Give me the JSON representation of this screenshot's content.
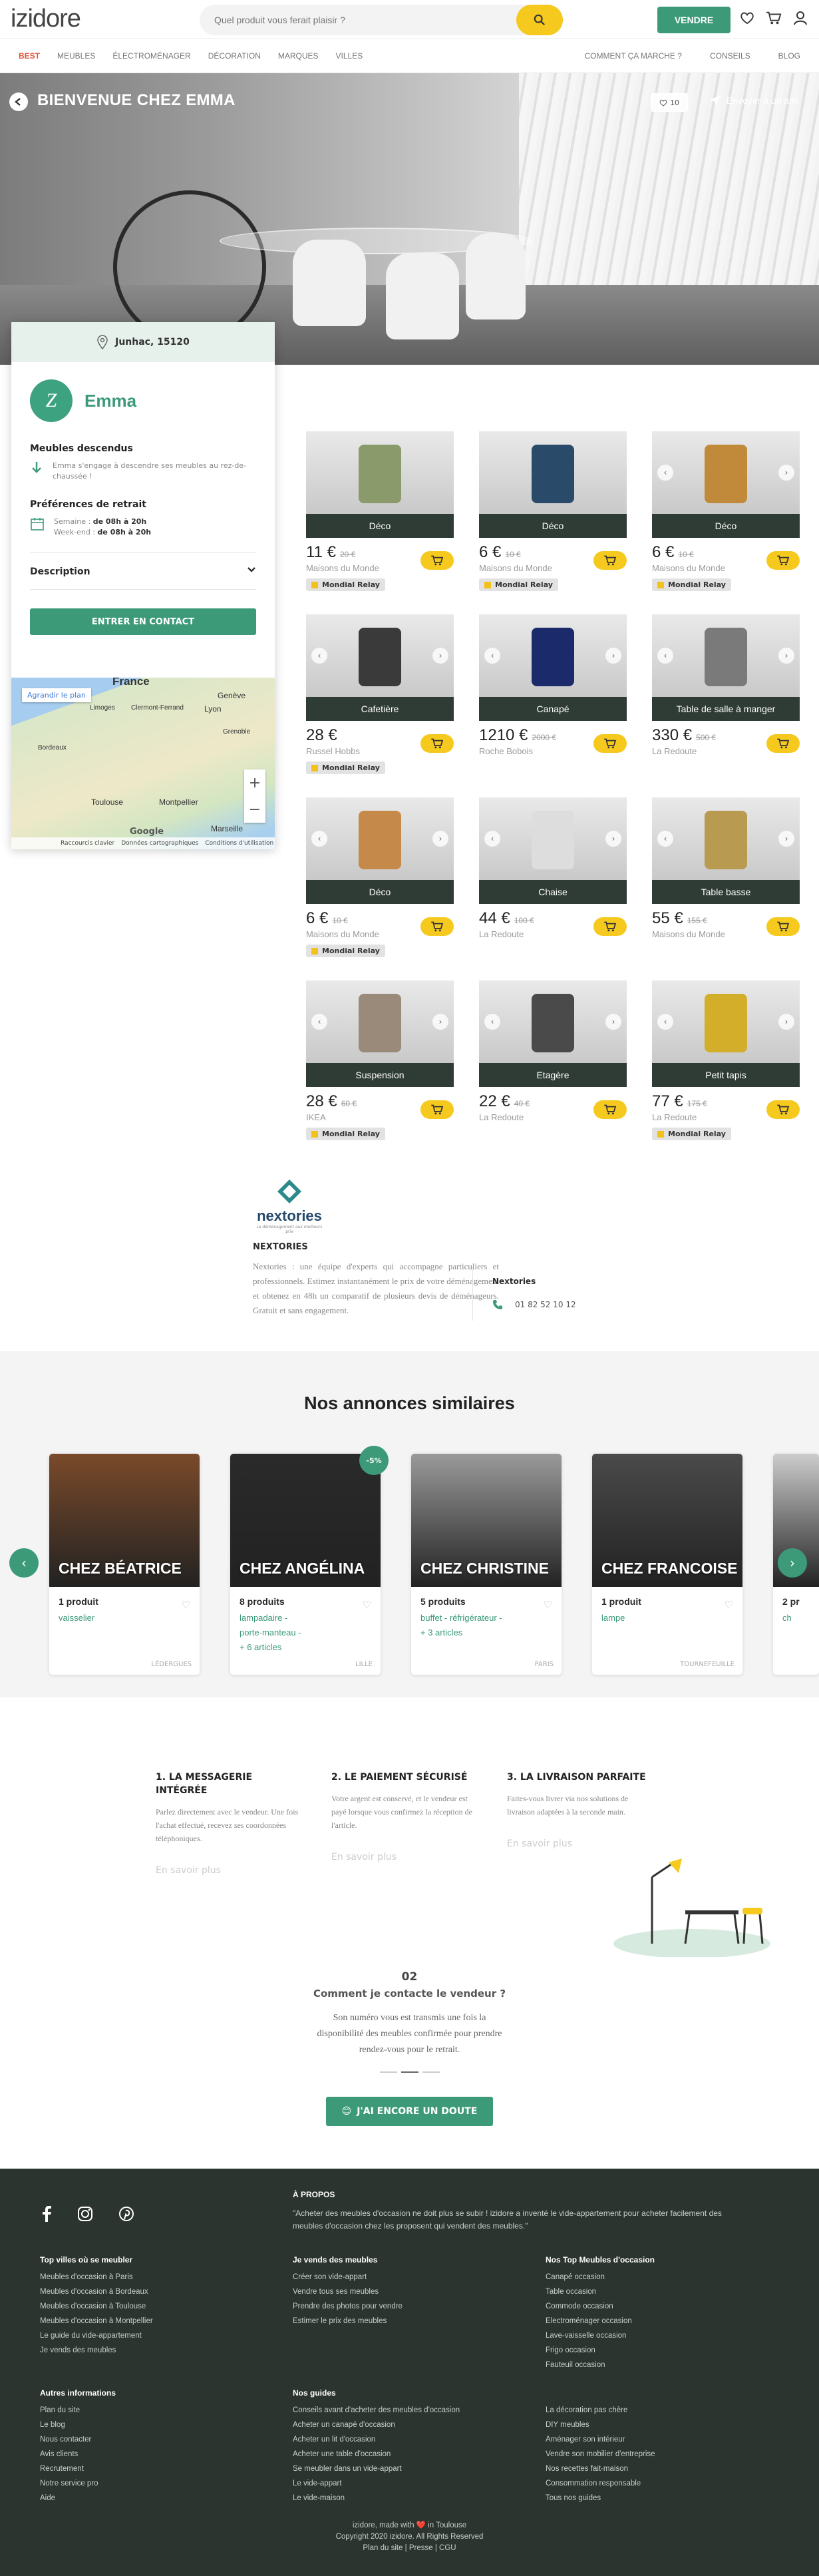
{
  "header": {
    "logo": "izidore",
    "search_placeholder": "Quel produit vous ferait plaisir ?",
    "sell_label": "VENDRE"
  },
  "nav": {
    "left": [
      "BEST",
      "MEUBLES",
      "ÉLECTROMÉNAGER",
      "DÉCORATION",
      "MARQUES",
      "VILLES"
    ],
    "right": [
      "COMMENT ÇA MARCHE ?",
      "CONSEILS",
      "BLOG"
    ]
  },
  "hero": {
    "title": "BIENVENUE CHEZ EMMA",
    "fav_count": "10",
    "share_label": "Envoyer à un ami"
  },
  "seller": {
    "location": "Junhac, 15120",
    "initial": "Z",
    "name": "Emma",
    "carry_title": "Meubles descendus",
    "carry_text": "Emma s'engage à descendre ses meubles au rez-de-chaussée !",
    "pickup_title": "Préférences de retrait",
    "week_label": "Semaine :",
    "week_hours": "de 08h à 20h",
    "weekend_label": "Week-end :",
    "weekend_hours": "de 08h à 20h",
    "desc_label": "Description",
    "contact_label": "ENTRER EN CONTACT"
  },
  "map": {
    "enlarge": "Agrandir le plan",
    "google": "Google",
    "attrib": [
      "Raccourcis clavier",
      "Données cartographiques",
      "Conditions d'utilisation"
    ],
    "cities": [
      "France",
      "Genève",
      "Limoges",
      "Clermont-Ferrand",
      "Lyon",
      "Grenoble",
      "Bordeaux",
      "Toulouse",
      "Montpellier",
      "Marseille"
    ]
  },
  "products": [
    {
      "cat": "Déco",
      "price": "11 €",
      "old": "20 €",
      "brand": "Maisons du Monde",
      "relay": "Mondial Relay",
      "color": "#8a9a6a"
    },
    {
      "cat": "Déco",
      "price": "6 €",
      "old": "10 €",
      "brand": "Maisons du Monde",
      "relay": "Mondial Relay",
      "color": "#2a4a6a"
    },
    {
      "cat": "Déco",
      "price": "6 €",
      "old": "10 €",
      "brand": "Maisons du Monde",
      "relay": "Mondial Relay",
      "color": "#c08a3a"
    },
    {
      "cat": "Cafetière",
      "price": "28 €",
      "old": "",
      "brand": "Russel Hobbs",
      "relay": "Mondial Relay",
      "color": "#3a3a3a"
    },
    {
      "cat": "Canapé",
      "price": "1210 €",
      "old": "2000 €",
      "brand": "Roche Bobois",
      "relay": "",
      "color": "#1a2a6a"
    },
    {
      "cat": "Table de salle à manger",
      "price": "330 €",
      "old": "500 €",
      "brand": "La Redoute",
      "relay": "",
      "color": "#7a7a7a"
    },
    {
      "cat": "Déco",
      "price": "6 €",
      "old": "10 €",
      "brand": "Maisons du Monde",
      "relay": "Mondial Relay",
      "color": "#c58a4a"
    },
    {
      "cat": "Chaise",
      "price": "44 €",
      "old": "100 €",
      "brand": "La Redoute",
      "relay": "",
      "color": "#dddddd"
    },
    {
      "cat": "Table basse",
      "price": "55 €",
      "old": "155 €",
      "brand": "Maisons du Monde",
      "relay": "",
      "color": "#b89a50"
    },
    {
      "cat": "Suspension",
      "price": "28 €",
      "old": "60 €",
      "brand": "IKEA",
      "relay": "Mondial Relay",
      "color": "#9a8a7a"
    },
    {
      "cat": "Etagère",
      "price": "22 €",
      "old": "40 €",
      "brand": "La Redoute",
      "relay": "",
      "color": "#4a4a4a"
    },
    {
      "cat": "Petit tapis",
      "price": "77 €",
      "old": "175 €",
      "brand": "La Redoute",
      "relay": "Mondial Relay",
      "color": "#d2ae2a"
    }
  ],
  "partner": {
    "logo": "nextories",
    "tagline": "Le déménagement aux meilleurs prix",
    "name": "NEXTORIES",
    "text": "Nextories : une équipe d'experts qui accompagne particuliers et professionnels. Estimez instantanément le prix de votre déménagement et obtenez en 48h un comparatif de plusieurs devis de déménageurs. Gratuit et sans engagement.",
    "contact_name": "Nextories",
    "phone": "01 82 52 10 12"
  },
  "similar": {
    "title": "Nos annonces similaires",
    "discount": "-5%",
    "cards": [
      {
        "name": "CHEZ BÉATRICE",
        "count": "1 produit",
        "tags": [
          "vaisselier"
        ],
        "city": "LÉDERGUES",
        "color": "#7a4a2a"
      },
      {
        "name": "CHEZ ANGÉLINA",
        "count": "8 produits",
        "tags": [
          "lampadaire -",
          "porte-manteau -",
          "+ 6 articles"
        ],
        "city": "LILLE",
        "color": "#2a2a2a"
      },
      {
        "name": "CHEZ CHRISTINE",
        "count": "5 produits",
        "tags": [
          "buffet - réfrigérateur -",
          "+ 3 articles"
        ],
        "city": "PARIS",
        "color": "#9a9a9a"
      },
      {
        "name": "CHEZ FRANCOISE",
        "count": "1 produit",
        "tags": [
          "lampe"
        ],
        "city": "TOURNEFEUILLE",
        "color": "#4a4a4a"
      },
      {
        "name": "",
        "count": "2 pr",
        "tags": [
          "ch"
        ],
        "city": "",
        "color": "#cccccc"
      }
    ]
  },
  "steps": [
    {
      "title": "1. LA MESSAGERIE INTÉGRÉE",
      "text": "Parlez directement avec le vendeur. Une fois l'achat effectué, recevez ses coordonnées téléphoniques.",
      "more": "En savoir plus"
    },
    {
      "title": "2. LE PAIEMENT SÉCURISÉ",
      "text": "Votre argent est conservé, et le vendeur est payé lorsque vous confirmez la réception de l'article.",
      "more": "En savoir plus"
    },
    {
      "title": "3. LA LIVRAISON PARFAITE",
      "text": "Faites-vous livrer via nos solutions de livraison adaptées à la seconde main.",
      "more": "En savoir plus"
    }
  ],
  "faq": {
    "num": "02",
    "question": "Comment je contacte le vendeur ?",
    "answer": "Son numéro vous est transmis une fois la disponibilité des meubles confirmée pour prendre rendez-vous pour le retrait.",
    "button": "J'AI ENCORE UN DOUTE"
  },
  "footer": {
    "about_title": "À PROPOS",
    "about_text": "\"Acheter des meubles d'occasion ne doit plus se subir ! izidore a inventé le vide-appartement pour acheter facilement des meubles d'occasion chez les proposent qui vendent des meubles.\"",
    "col1_title": "Top villes où se meubler",
    "col1": [
      "Meubles d'occasion à Paris",
      "Meubles d'occasion à Bordeaux",
      "Meubles d'occasion à Toulouse",
      "Meubles d'occasion à Montpellier",
      "Le guide du vide-appartement",
      "Je vends des meubles"
    ],
    "col2_title": "Je vends des meubles",
    "col2": [
      "Créer son vide-appart",
      "Vendre tous ses meubles",
      "Prendre des photos pour vendre",
      "Estimer le prix des meubles"
    ],
    "col3_title": "Nos Top Meubles d'occasion",
    "col3": [
      "Canapé occasion",
      "Table occasion",
      "Commode occasion",
      "Electroménager occasion",
      "Lave-vaisselle occasion",
      "Frigo occasion",
      "Fauteuil occasion"
    ],
    "col4_title": "Autres informations",
    "col4": [
      "Plan du site",
      "Le blog",
      "Nous contacter",
      "Avis clients",
      "Recrutement",
      "Notre service pro",
      "Aide"
    ],
    "col5_title": "Nos guides",
    "col5": [
      "Conseils avant d'acheter des meubles d'occasion",
      "Acheter un canapé d'occasion",
      "Acheter un lit d'occasion",
      "Acheter une table d'occasion",
      "Se meubler dans un vide-appart",
      "Le vide-appart",
      "Le vide-maison"
    ],
    "col6": [
      "La décoration pas chère",
      "DIY meubles",
      "Aménager son intérieur",
      "Vendre son mobilier d'entreprise",
      "Nos recettes fait-maison",
      "Consommation responsable",
      "Tous nos guides"
    ],
    "made": "izidore, made with ❤️ in Toulouse",
    "copyright": "Copyright 2020 izidore. All Rights Reserved",
    "legal": "Plan du site | Presse | CGU"
  }
}
